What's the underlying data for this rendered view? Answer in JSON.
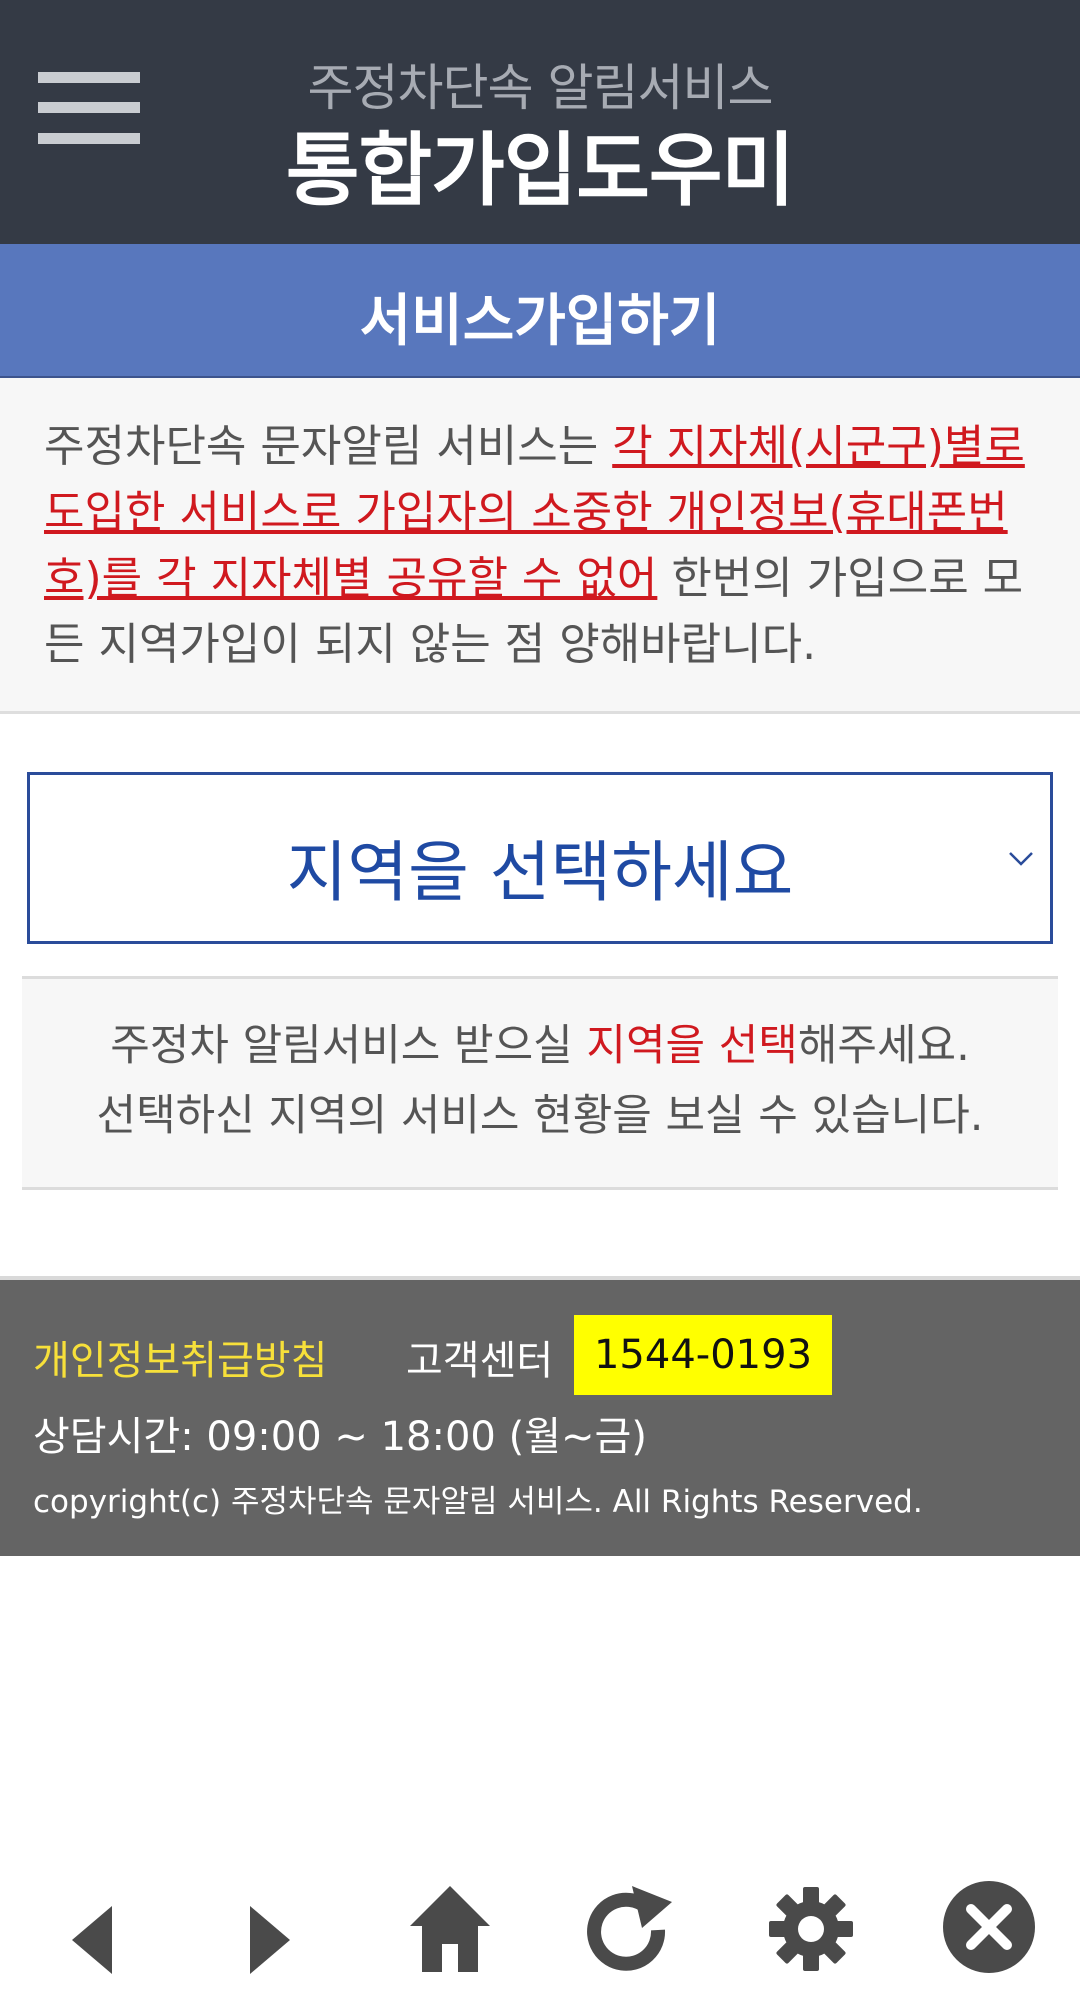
{
  "header": {
    "subtitle": "주정차단속 알림서비스",
    "title": "통합가입도우미"
  },
  "tab": {
    "title": "서비스가입하기"
  },
  "notice": {
    "text_before": "주정차단속 문자알림 서비스는 ",
    "text_highlight": "각 지자체(시군구)별로 도입한 서비스로 가입자의 소중한 개인정보(휴대폰번호)를 각 지자체별 공유할 수 없어",
    "text_after": " 한번의 가입으로 모든 지역가입이 되지 않는 점 양해바랍니다."
  },
  "region_select": {
    "placeholder": "지역을 선택하세요"
  },
  "info": {
    "line1_before": "주정차 알림서비스 받으실 ",
    "line1_highlight": "지역을 선택",
    "line1_after": "해주세요.",
    "line2": "선택하신 지역의 서비스 현황을 보실 수 있습니다."
  },
  "footer": {
    "privacy_label": "개인정보취급방침",
    "cs_label": "고객센터",
    "phone": "1544-0193",
    "hours": "상담시간: 09:00 ~ 18:00 (월~금)",
    "copyright": "copyright(c) 주정차단속 문자알림 서비스. All Rights Reserved."
  },
  "nav": {
    "icons": [
      "back-icon",
      "forward-icon",
      "home-icon",
      "refresh-icon",
      "settings-icon",
      "close-icon"
    ]
  },
  "colors": {
    "header_bg": "#343a45",
    "tab_bg": "#5877bd",
    "highlight_red": "#d0191f",
    "select_blue": "#1f4aa3",
    "footer_bg": "#646464",
    "phone_bg": "#ffff00",
    "privacy_yellow": "#f7e03a"
  }
}
